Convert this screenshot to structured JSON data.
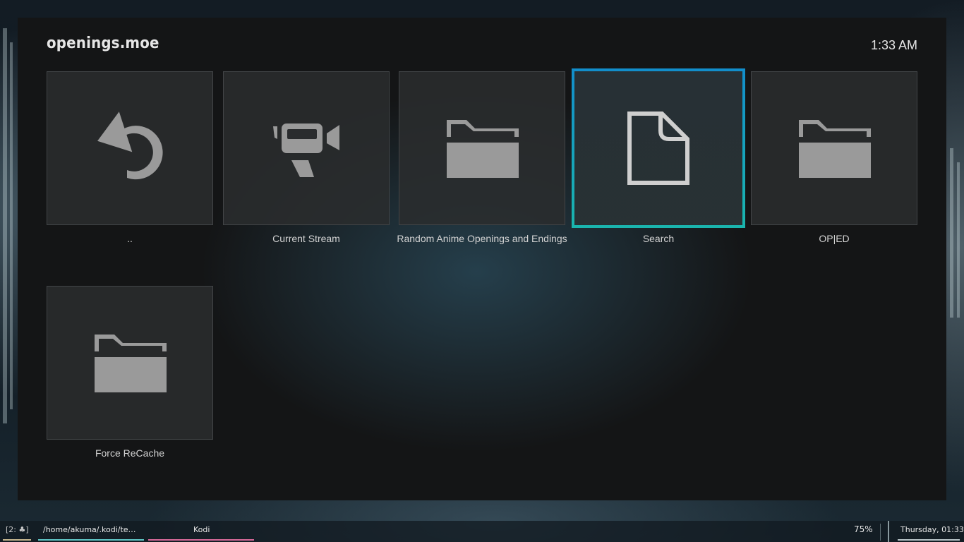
{
  "app": {
    "title": "openings.moe",
    "clock": "1:33 AM"
  },
  "items": [
    {
      "label": "..",
      "icon": "back-arrow-icon"
    },
    {
      "label": "Current Stream",
      "icon": "video-camera-icon"
    },
    {
      "label": "Random Anime Openings and Endings",
      "icon": "folder-icon"
    },
    {
      "label": "Search",
      "icon": "file-icon",
      "focused": true
    },
    {
      "label": "OP|ED",
      "icon": "folder-icon"
    },
    {
      "label": "Force ReCache",
      "icon": "folder-icon"
    }
  ],
  "taskbar": {
    "workspace": "[2: ♣]",
    "terminal_title": "/home/akuma/.kodi/tem...",
    "kodi_title": "Kodi",
    "volume": "75%",
    "datetime": "Thursday, 01:33"
  },
  "colors": {
    "focus_border_top": "#128ecb",
    "focus_border_bottom": "#1ab5ad",
    "icon_gray": "#9a9a9a",
    "accent_pink": "#d86a9a",
    "accent_cyan": "#60c7c7"
  }
}
